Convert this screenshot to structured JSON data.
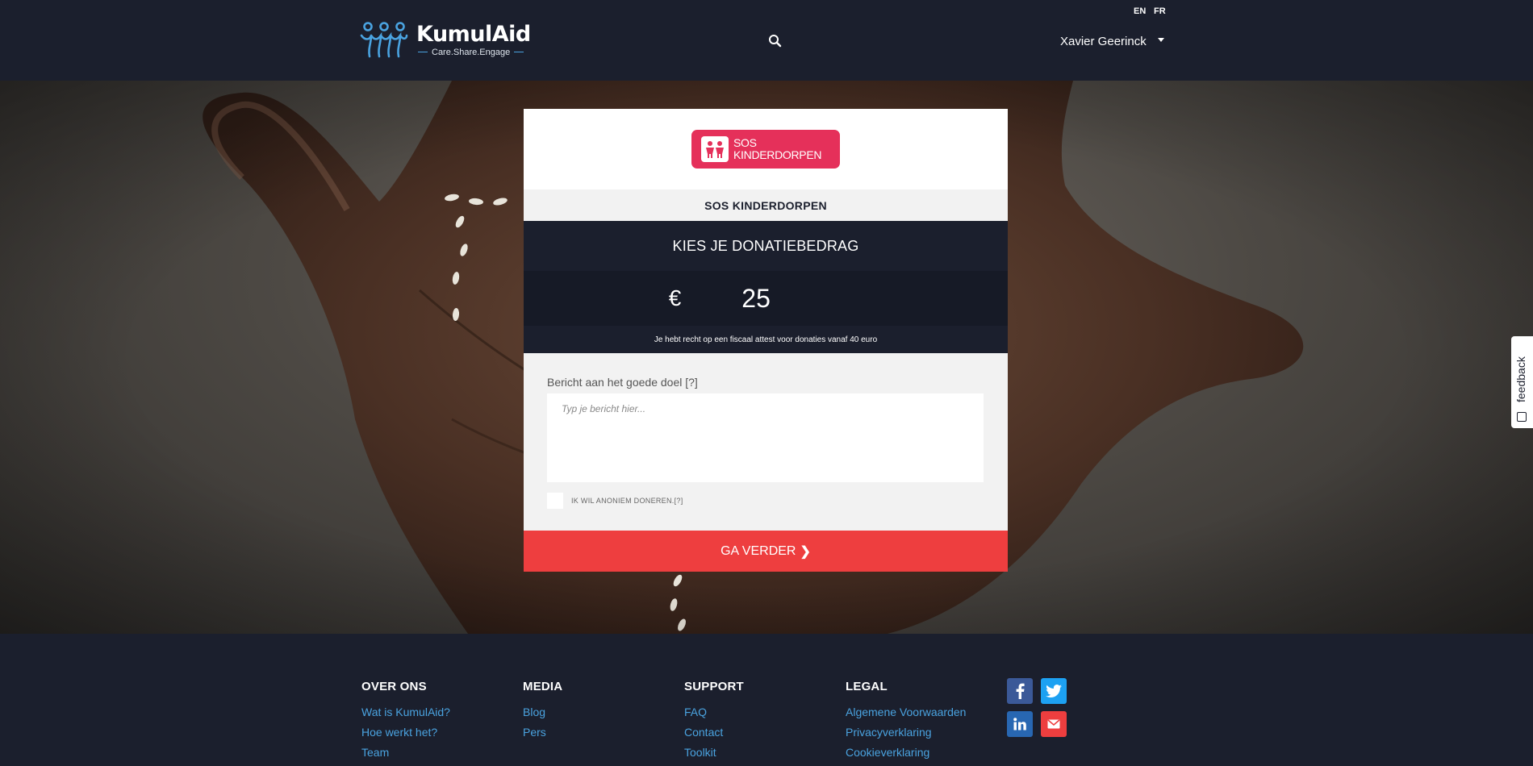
{
  "header": {
    "brand_name": "KumulAid",
    "brand_tagline": "Care.Share.Engage",
    "lang_en": "EN",
    "lang_fr": "FR",
    "user_name": "Xavier Geerinck",
    "search_icon": "search-icon"
  },
  "donation": {
    "org_logo_text_line1": "SOS",
    "org_logo_text_line2": "KINDERDORPEN",
    "org_name": "SOS KINDERDORPEN",
    "choose_amount_title": "KIES JE DONATIEBEDRAG",
    "currency_symbol": "€",
    "amount_value": "25",
    "fiscal_note": "Je hebt recht op een fiscaal attest voor donaties vanaf 40 euro",
    "message_label": "Bericht aan het goede doel [?]",
    "message_placeholder": "Typ je bericht hier...",
    "anonymous_label": "IK WIL ANONIEM DONEREN.[?]",
    "anonymous_checked": false,
    "continue_label": "GA VERDER",
    "brand_color": "#ee3e3f",
    "org_color": "#e5305a"
  },
  "feedback_tab": {
    "label": "feedback"
  },
  "footer": {
    "columns": [
      {
        "title": "OVER ONS",
        "links": [
          "Wat is KumulAid?",
          "Hoe werkt het?",
          "Team"
        ]
      },
      {
        "title": "MEDIA",
        "links": [
          "Blog",
          "Pers"
        ]
      },
      {
        "title": "SUPPORT",
        "links": [
          "FAQ",
          "Contact",
          "Toolkit"
        ]
      },
      {
        "title": "LEGAL",
        "links": [
          "Algemene Voorwaarden",
          "Privacyverklaring",
          "Cookieverklaring"
        ]
      }
    ],
    "social": [
      "facebook-icon",
      "twitter-icon",
      "linkedin-icon",
      "mail-icon"
    ],
    "link_color": "#4aa3e0"
  }
}
